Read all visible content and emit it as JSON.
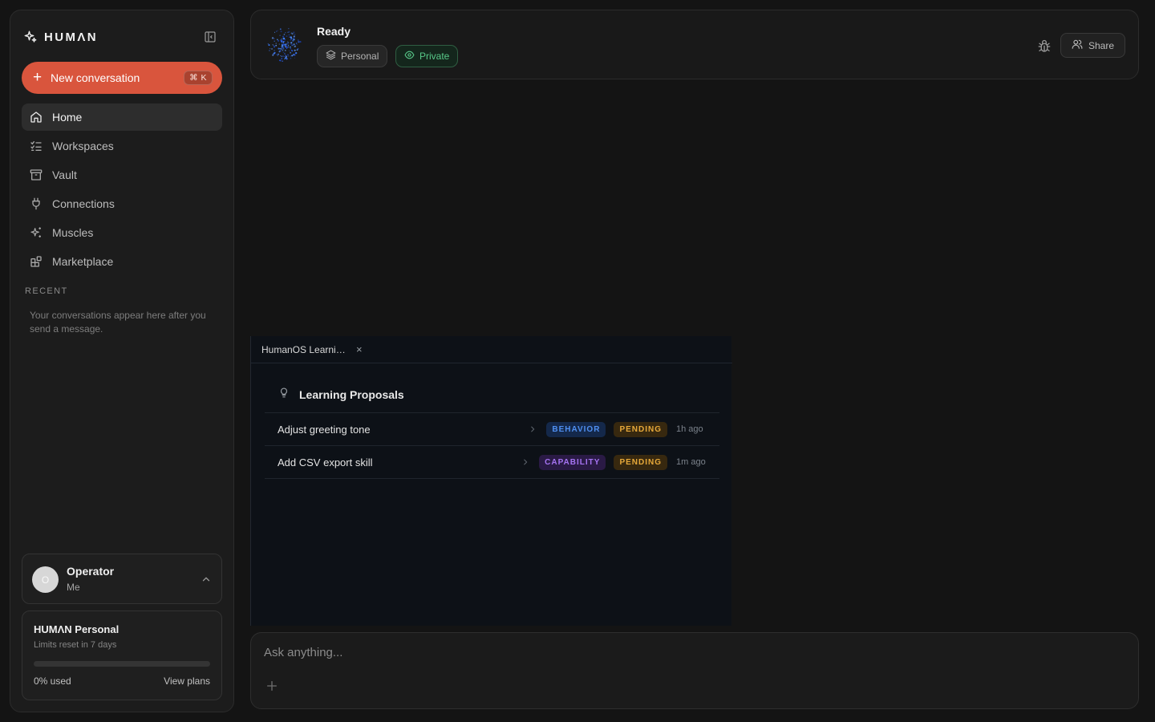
{
  "brand": {
    "name": "HUMΛN"
  },
  "sidebar": {
    "new_conversation": {
      "label": "New conversation",
      "shortcut": "⌘ K"
    },
    "nav": [
      {
        "label": "Home",
        "icon": "home-icon",
        "active": true
      },
      {
        "label": "Workspaces",
        "icon": "list-checks-icon",
        "active": false
      },
      {
        "label": "Vault",
        "icon": "archive-icon",
        "active": false
      },
      {
        "label": "Connections",
        "icon": "plug-icon",
        "active": false
      },
      {
        "label": "Muscles",
        "icon": "sparkles-icon",
        "active": false
      },
      {
        "label": "Marketplace",
        "icon": "blocks-icon",
        "active": false
      }
    ],
    "recent": {
      "heading": "RECENT",
      "empty": "Your conversations appear here after you send a message."
    },
    "user": {
      "initial": "O",
      "name": "Operator",
      "subtitle": "Me"
    },
    "plan": {
      "title": "HUMΛN Personal",
      "subtitle": "Limits reset in 7 days",
      "usage_fraction": 0,
      "used_label": "0% used",
      "link": "View plans"
    }
  },
  "header": {
    "status": "Ready",
    "pills": {
      "personal": "Personal",
      "private": "Private"
    },
    "share_label": "Share"
  },
  "panel": {
    "tab_title": "HumanOS Learning Proposals",
    "close_glyph": "×",
    "title": "Learning Proposals",
    "proposals": [
      {
        "name": "Adjust greeting tone",
        "type": "BEHAVIOR",
        "status": "PENDING",
        "time": "1h ago"
      },
      {
        "name": "Add CSV export skill",
        "type": "CAPABILITY",
        "status": "PENDING",
        "time": "1m ago"
      }
    ]
  },
  "composer": {
    "placeholder": "Ask anything..."
  },
  "colors": {
    "accent": "#d9553d",
    "private_green": "#58c989",
    "behavior_blue": "#4f8ff0",
    "capability_purple": "#a674f3",
    "pending_amber": "#e7a93a"
  }
}
